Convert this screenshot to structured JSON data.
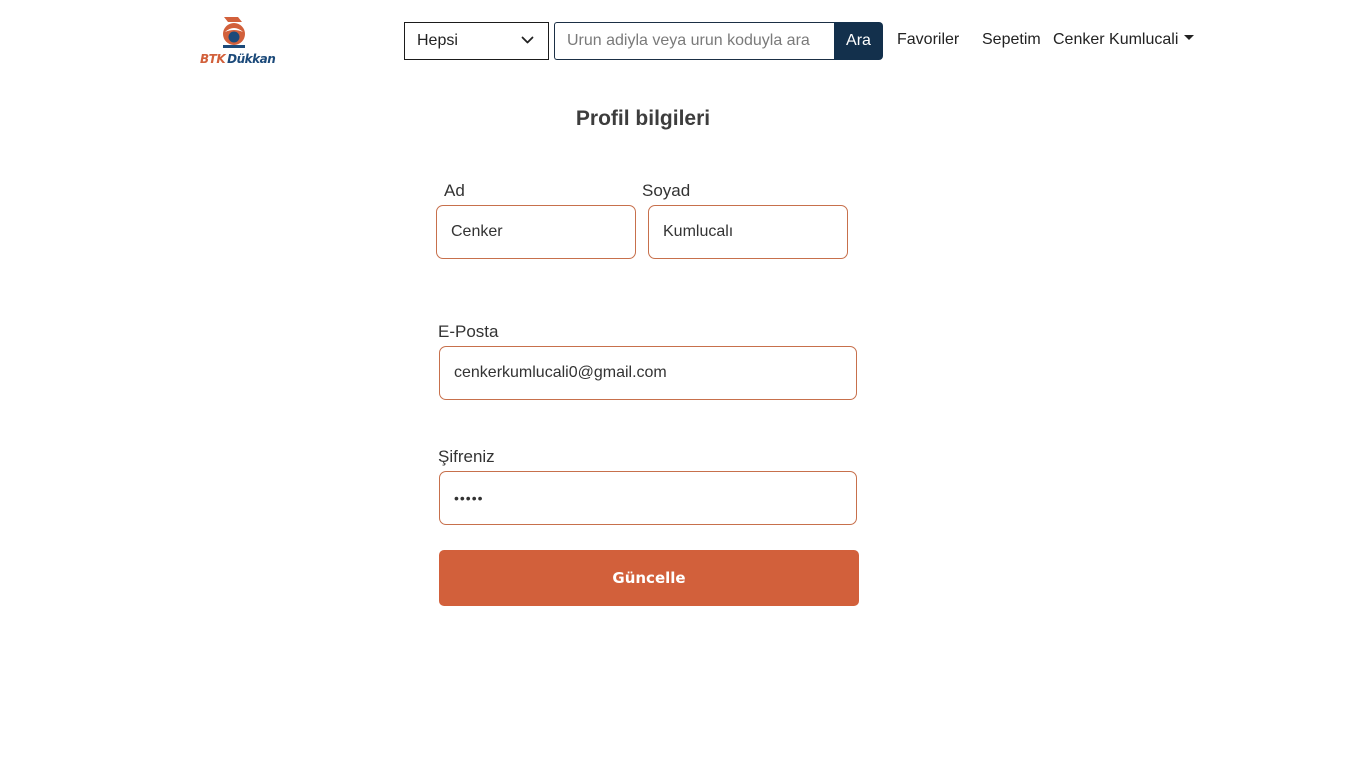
{
  "header": {
    "logo": {
      "text_primary": "BTK",
      "text_secondary": "Dükkan",
      "primary_color": "#d2603b",
      "secondary_color": "#1c4a7a"
    },
    "category_select": {
      "selected": "Hepsi",
      "icon": "chevron-down-icon"
    },
    "search": {
      "placeholder": "Urun adiyla veya urun koduyla ara",
      "value": "",
      "button_label": "Ara"
    },
    "nav": {
      "favorites": "Favoriler",
      "cart": "Sepetim",
      "user": "Cenker Kumlucali",
      "user_icon": "caret-down-icon"
    }
  },
  "profile": {
    "title": "Profil bilgileri",
    "first_name": {
      "label": "Ad",
      "value": "Cenker"
    },
    "last_name": {
      "label": "Soyad",
      "value": "Kumlucalı"
    },
    "email": {
      "label": "E-Posta",
      "value": "cenkerkumlucali0@gmail.com"
    },
    "password": {
      "label": "Şifreniz",
      "value": "12345"
    },
    "submit_label": "Güncelle"
  },
  "colors": {
    "accent": "#d2603b",
    "navy": "#13304c",
    "input_border": "#c7704c"
  }
}
